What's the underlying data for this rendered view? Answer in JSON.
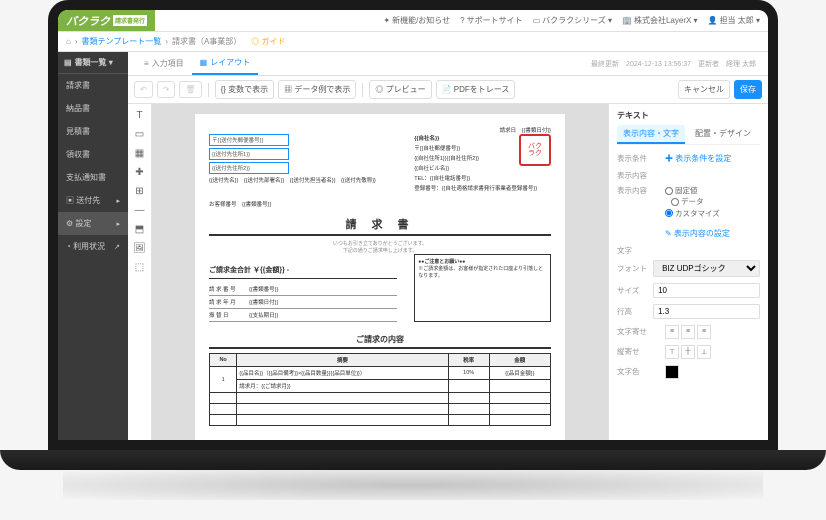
{
  "logo": {
    "main": "バクラク",
    "sub": "請求書発行"
  },
  "topbar": [
    {
      "icon": "✦",
      "label": "新機能/お知らせ"
    },
    {
      "icon": "?",
      "label": "サポートサイト"
    },
    {
      "icon": "▭",
      "label": "バクラクシリーズ ▾"
    },
    {
      "icon": "🏢",
      "label": "株式会社LayerX ▾"
    },
    {
      "icon": "👤",
      "label": "担当 太郎 ▾"
    }
  ],
  "breadcrumb": {
    "home": "⌂",
    "b1": "書類テンプレート一覧",
    "b2": "請求書（A事業部）",
    "guide": "◎ ガイド"
  },
  "sidebar": {
    "head": "書類一覧 ▾",
    "items": [
      "請求書",
      "納品書",
      "見積書",
      "領収書",
      "支払通知書"
    ],
    "footer": [
      {
        "label": "送付先",
        "icon": "▸"
      },
      {
        "label": "設定",
        "icon": "▸",
        "gear": "⚙",
        "active": true
      },
      {
        "label": "利用状況",
        "icon": "↗"
      }
    ]
  },
  "tabs": {
    "t1": "入力項目",
    "t2": "レイアウト",
    "meta": "最終更新　2024-12-13 13:56:37　更新者　経理 太郎"
  },
  "toolbar": {
    "undo": "↶",
    "redo": "↷",
    "trash": "🗑",
    "varbtn": "{} 変数で表示",
    "databtn": "▦ データ例で表示",
    "preview": "◎ プレビュー",
    "trace": "📄 PDFをトレース",
    "cancel": "キャンセル",
    "save": "保存"
  },
  "tray": [
    "T",
    "▭",
    "▦",
    "✚",
    "⊞",
    "—",
    "⬒",
    "🖼",
    "⬚"
  ],
  "doc": {
    "date_label": "請求日　{{書類日付}}",
    "postal": "〒{{送付先郵便番号}}",
    "addr1": "{{送付先住所1}}",
    "addr2": "{{送付先住所2}}",
    "recipient": "{{送付先名}}　{{送付先部署名}}　{{送付先担当者名}}　{{送付先敬称}}",
    "company": "{{自社名}}",
    "c_postal": "〒{{自社郵便番号}}",
    "c_addr": "{{自社住所1}}{{自社住所2}}",
    "c_build": "{{自社ビル名}}",
    "c_tel": "TEL：{{自社電話番号}}",
    "c_reg": "登録番号：{{自社適格請求書発行事業者登録番号}}",
    "customer_no": "お客様番号　{{書類番号}}",
    "title": "請 求 書",
    "sub1": "いつもお引き立てありがとうございます。",
    "sub2": "下記の通りご請求申し上げます。",
    "amount_label": "ご請求金合計 ￥{{金額}} -",
    "rows": [
      {
        "l": "請 求 番 号",
        "v": "{{書類番号}}"
      },
      {
        "l": "請 求 年 月",
        "v": "{{書類日付}}"
      },
      {
        "l": "振 替 日",
        "v": "{{支払期日}}"
      }
    ],
    "note_head": "●●ご注意とお願い●●",
    "note_body": "※ご請求金額は、お客様が指定された口座より引落しとなります。",
    "section": "ご請求の内容",
    "table": {
      "headers": [
        "No",
        "摘要",
        "税率",
        "金額"
      ],
      "row1": [
        "1",
        "{{品目名}}（{{品目備考}}×{{品目数量}}{{品目単位}}）",
        "10%",
        "{{品目金額}}"
      ],
      "row1b": "請求月：{{ご請求月}}"
    }
  },
  "panel": {
    "title": "テキスト",
    "tabs": [
      "表示内容・文字",
      "配置・デザイン"
    ],
    "cond_label": "表示条件",
    "cond_link": "✚ 表示条件を設定",
    "content_head": "表示内容",
    "content_label": "表示内容",
    "r_fixed": "固定値",
    "r_data": "データ",
    "r_custom": "カスタマイズ",
    "content_link": "✎ 表示内容の設定",
    "text_head": "文字",
    "font_label": "フォント",
    "font_value": "BIZ UDPゴシック",
    "size_label": "サイズ",
    "size_value": "10",
    "lh_label": "行高",
    "lh_value": "1.3",
    "align_label": "文字寄せ",
    "valign_label": "縦寄せ",
    "color_label": "文字色"
  }
}
